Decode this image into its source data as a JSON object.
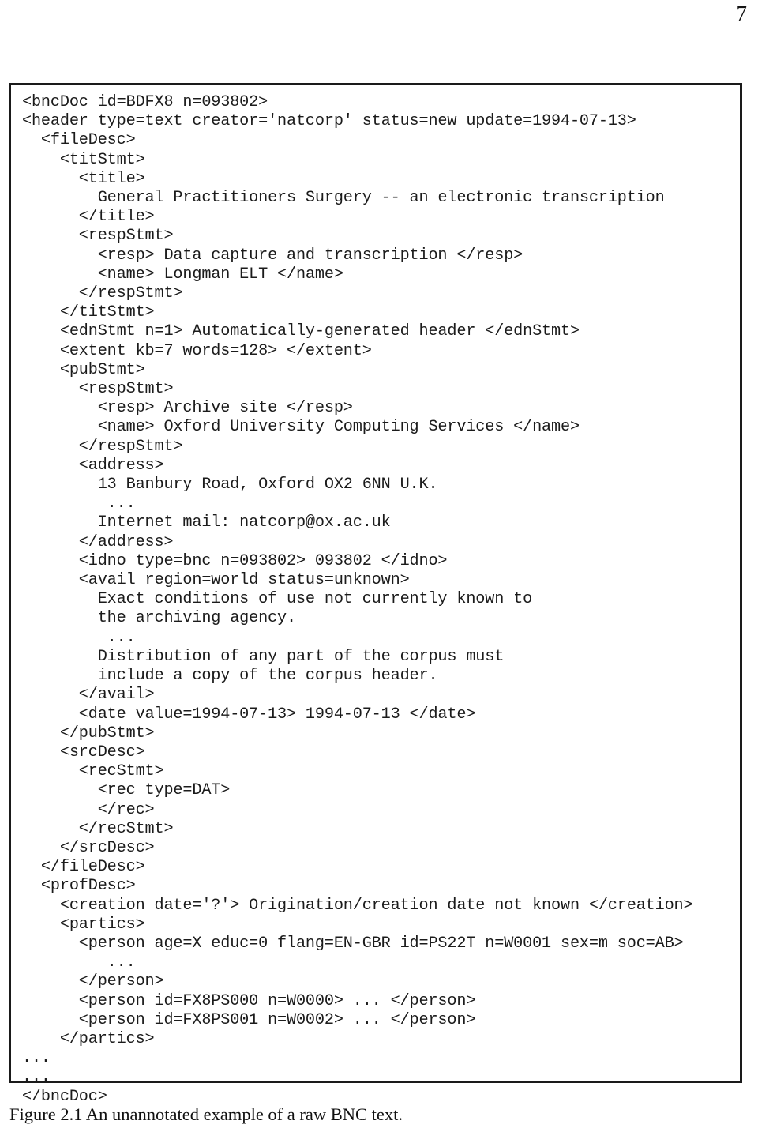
{
  "page": {
    "number": "7",
    "background_color": "#ffffff",
    "text_color": "#1b1b1b",
    "border_color": "#1a1a1a"
  },
  "figure": {
    "caption": "Figure 2.1 An unannotated example of a raw BNC text.",
    "listing_language": "SGML",
    "lines": [
      "<bncDoc id=BDFX8 n=093802>",
      "<header type=text creator='natcorp' status=new update=1994-07-13>",
      "  <fileDesc>",
      "    <titStmt>",
      "      <title>",
      "        General Practitioners Surgery -- an electronic transcription",
      "      </title>",
      "      <respStmt>",
      "        <resp> Data capture and transcription </resp>",
      "        <name> Longman ELT </name>",
      "      </respStmt>",
      "    </titStmt>",
      "    <ednStmt n=1> Automatically-generated header </ednStmt>",
      "    <extent kb=7 words=128> </extent>",
      "    <pubStmt>",
      "      <respStmt>",
      "        <resp> Archive site </resp>",
      "        <name> Oxford University Computing Services </name>",
      "      </respStmt>",
      "      <address>",
      "        13 Banbury Road, Oxford OX2 6NN U.K.",
      "         ...",
      "        Internet mail: natcorp@ox.ac.uk",
      "      </address>",
      "      <idno type=bnc n=093802> 093802 </idno>",
      "      <avail region=world status=unknown>",
      "        Exact conditions of use not currently known to",
      "        the archiving agency.",
      "         ...",
      "        Distribution of any part of the corpus must",
      "        include a copy of the corpus header.",
      "      </avail>",
      "      <date value=1994-07-13> 1994-07-13 </date>",
      "    </pubStmt>",
      "    <srcDesc>",
      "      <recStmt>",
      "        <rec type=DAT>",
      "        </rec>",
      "      </recStmt>",
      "    </srcDesc>",
      "  </fileDesc>",
      "  <profDesc>",
      "    <creation date='?'> Origination/creation date not known </creation>",
      "    <partics>",
      "      <person age=X educ=0 flang=EN-GBR id=PS22T n=W0001 sex=m soc=AB>",
      "         ...",
      "      </person>",
      "      <person id=FX8PS000 n=W0000> ... </person>",
      "      <person id=FX8PS001 n=W0002> ... </person>",
      "    </partics>",
      "...",
      "...",
      "</bncDoc>"
    ]
  }
}
